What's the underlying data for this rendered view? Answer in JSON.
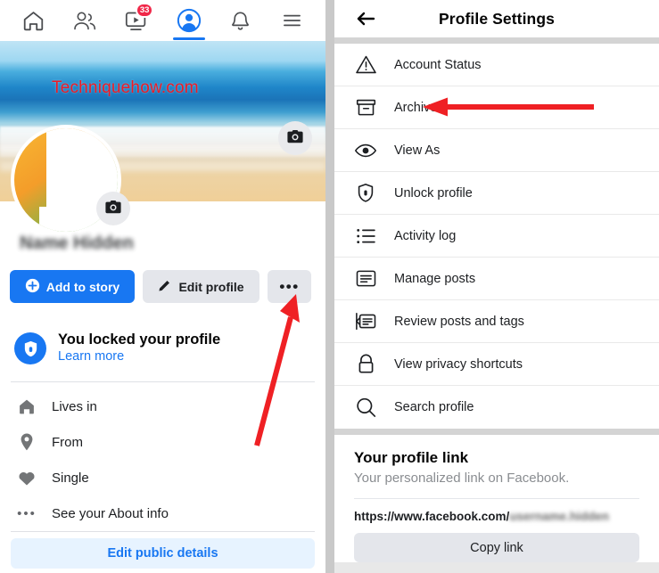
{
  "left_panel": {
    "nav": {
      "items": [
        {
          "name": "home",
          "icon": "home-icon",
          "active": false,
          "badge": ""
        },
        {
          "name": "friends",
          "icon": "friends-icon",
          "active": false,
          "badge": ""
        },
        {
          "name": "video",
          "icon": "video-icon",
          "active": false,
          "badge": "33"
        },
        {
          "name": "profile",
          "icon": "profile-icon",
          "active": true,
          "badge": ""
        },
        {
          "name": "notifications",
          "icon": "bell-icon",
          "active": false,
          "badge": ""
        },
        {
          "name": "menu",
          "icon": "hamburger-menu-icon",
          "active": false,
          "badge": ""
        }
      ]
    },
    "cover": {
      "watermark": "Techniquehow.com",
      "camera_icon": "camera-icon"
    },
    "avatar": {
      "camera_icon": "camera-icon"
    },
    "profile_name": "Name Hidden",
    "buttons": {
      "add_to_story": "Add to story",
      "edit_profile": "Edit profile",
      "more": "•••"
    },
    "locked_notice": {
      "title": "You locked your profile",
      "link": "Learn more",
      "icon": "shield-lock-icon"
    },
    "info_rows": [
      {
        "icon": "house-icon",
        "label": "Lives in"
      },
      {
        "icon": "location-pin-icon",
        "label": "From"
      },
      {
        "icon": "heart-icon",
        "label": "Single"
      },
      {
        "icon": "ellipsis-icon",
        "label": "See your About info"
      }
    ],
    "edit_public_details": "Edit public details"
  },
  "right_panel": {
    "header": {
      "back_icon": "back-arrow-icon",
      "title": "Profile Settings"
    },
    "menu_items": [
      {
        "icon": "warning-triangle-icon",
        "label": "Account Status"
      },
      {
        "icon": "archive-box-icon",
        "label": "Archive"
      },
      {
        "icon": "eye-icon",
        "label": "View As"
      },
      {
        "icon": "shield-lock-icon",
        "label": "Unlock profile"
      },
      {
        "icon": "list-icon",
        "label": "Activity log"
      },
      {
        "icon": "post-card-icon",
        "label": "Manage posts"
      },
      {
        "icon": "review-posts-icon",
        "label": "Review posts and tags"
      },
      {
        "icon": "padlock-icon",
        "label": "View privacy shortcuts"
      },
      {
        "icon": "magnifier-icon",
        "label": "Search profile"
      }
    ],
    "profile_link": {
      "title": "Your profile link",
      "subtitle": "Your personalized link on Facebook.",
      "url_prefix": "https://www.facebook.com/",
      "url_blurred": "username.hidden",
      "copy_button": "Copy link"
    },
    "cursor_icon": "zoom-in-cursor-icon"
  },
  "annotations": {
    "arrow_to_archive": "red-arrow-pointing-left",
    "arrow_to_more_button": "red-arrow-pointing-up-right"
  },
  "colors": {
    "facebook_blue": "#1877f2",
    "annotation_red": "#ee1b24",
    "badge_red": "#f02849",
    "button_gray": "#e4e6eb",
    "page_gray": "#c9c9c9"
  }
}
